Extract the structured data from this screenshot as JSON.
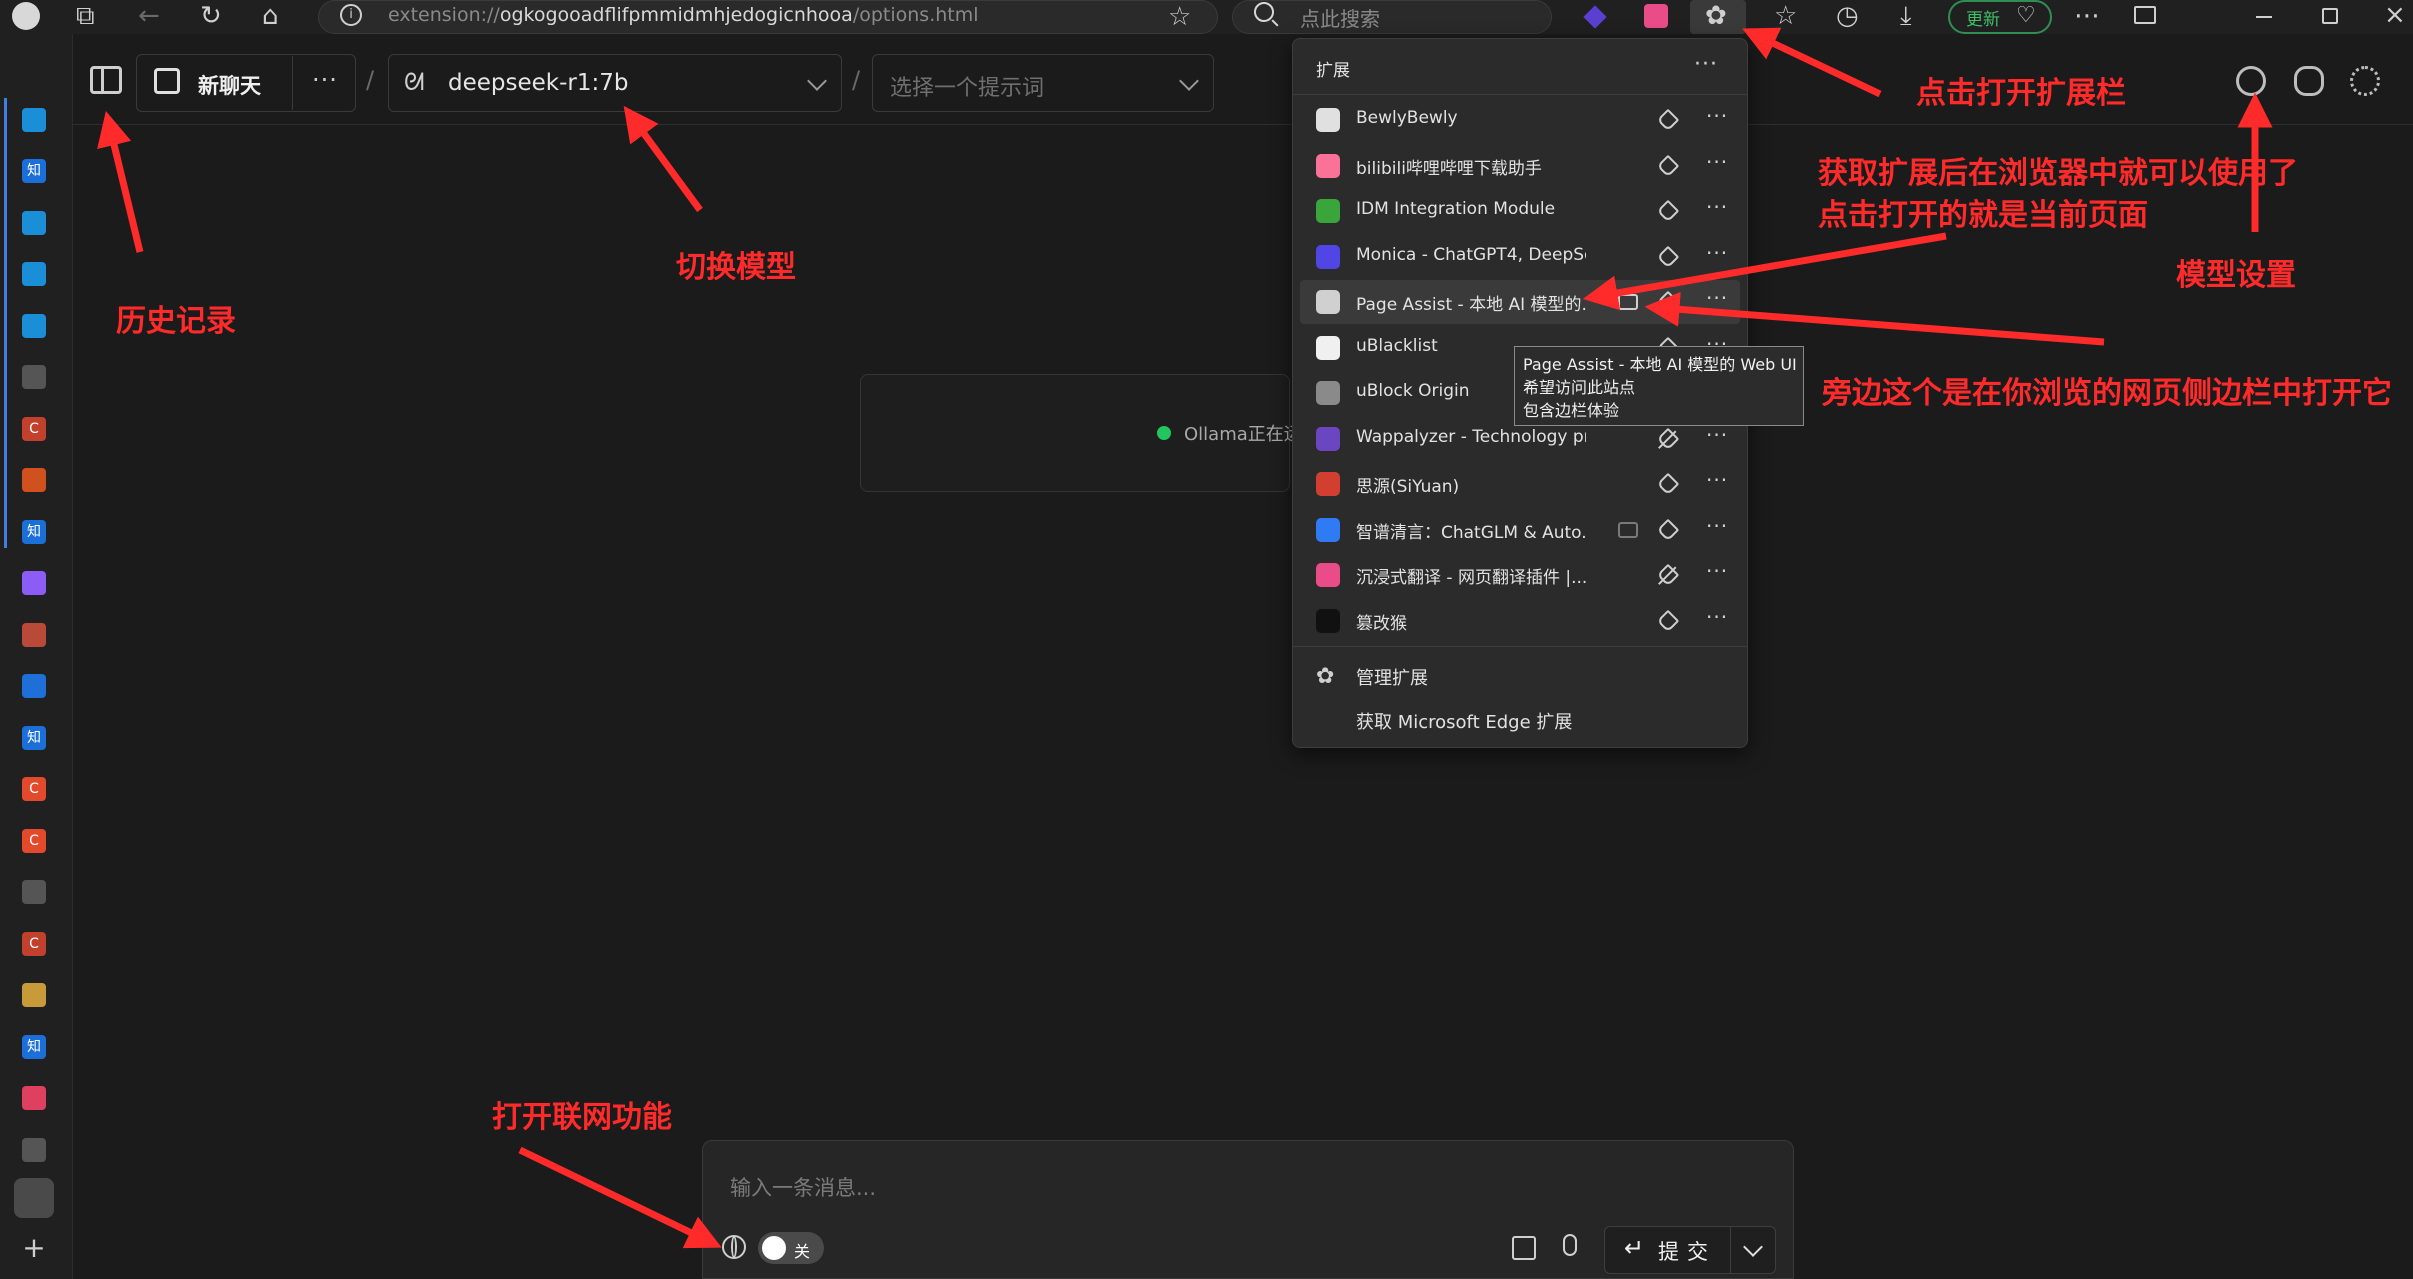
{
  "browser": {
    "url_prefix": "extension://",
    "url_host": "ogkogooadflifpmmidmhjedogicnhooa",
    "url_path": "/options.html",
    "search_placeholder": "点此搜索",
    "update_label": "更新"
  },
  "rail": {
    "items": [
      {
        "icon": "tab-icon",
        "text": "",
        "color": "#202020"
      },
      {
        "icon": "bilibili-icon",
        "text": "",
        "color": "#1a8fd8"
      },
      {
        "icon": "zhihu-icon",
        "text": "知",
        "color": "#1a6fd8"
      },
      {
        "icon": "bilibili-icon",
        "text": "",
        "color": "#1a8fd8"
      },
      {
        "icon": "bilibili-icon",
        "text": "",
        "color": "#1a8fd8"
      },
      {
        "icon": "bilibili-icon",
        "text": "",
        "color": "#1a8fd8"
      },
      {
        "icon": "bell-icon",
        "text": "",
        "color": "#555555"
      },
      {
        "icon": "c-icon",
        "text": "C",
        "color": "#c2412d"
      },
      {
        "icon": "ubuntu-icon",
        "text": "",
        "color": "#d0511d"
      },
      {
        "icon": "zhihu-icon",
        "text": "知",
        "color": "#1a6fd8"
      },
      {
        "icon": "app-icon",
        "text": "",
        "color": "#8b5cf6"
      },
      {
        "icon": "bus-icon",
        "text": "",
        "color": "#b94a3a"
      },
      {
        "icon": "search-icon",
        "text": "",
        "color": "#1e6fd8"
      },
      {
        "icon": "zhihu-icon",
        "text": "知",
        "color": "#1a6fd8"
      },
      {
        "icon": "c-icon",
        "text": "C",
        "color": "#e34a2b"
      },
      {
        "icon": "c-icon",
        "text": "C",
        "color": "#e34a2b"
      },
      {
        "icon": "bug-icon",
        "text": "",
        "color": "#555555"
      },
      {
        "icon": "c-icon",
        "text": "C",
        "color": "#c2412d"
      },
      {
        "icon": "house-icon",
        "text": "",
        "color": "#c79a3a"
      },
      {
        "icon": "zhihu-icon",
        "text": "知",
        "color": "#1a6fd8"
      },
      {
        "icon": "app-icon",
        "text": "",
        "color": "#e04060"
      },
      {
        "icon": "calendar-icon",
        "text": "",
        "color": "#555555"
      },
      {
        "icon": "chat-icon",
        "text": "",
        "color": "#4a4a4a"
      },
      {
        "icon": "plus-icon",
        "text": "+",
        "color": "#202020"
      }
    ]
  },
  "header": {
    "new_chat_label": "新聊天",
    "model_label": "deepseek-r1:7b",
    "prompt_placeholder": "选择一个提示词"
  },
  "status": {
    "text": "Ollama正在运"
  },
  "extensions_panel": {
    "title": "扩展",
    "items": [
      {
        "name": "BewlyBewly",
        "icon_color": "#e0e0e0",
        "pinned": true,
        "sidebar": false,
        "highlight": false
      },
      {
        "name": "bilibili哔哩哔哩下载助手",
        "icon_color": "#fb7299",
        "pinned": true,
        "sidebar": false,
        "highlight": false
      },
      {
        "name": "IDM Integration Module",
        "icon_color": "#3aa53a",
        "pinned": true,
        "sidebar": false,
        "highlight": false
      },
      {
        "name": "Monica - ChatGPT4, DeepSe...",
        "icon_color": "#4f46e5",
        "pinned": true,
        "sidebar": false,
        "highlight": false
      },
      {
        "name": "Page Assist - 本地 AI 模型的...",
        "icon_color": "#d0d0d0",
        "pinned": true,
        "sidebar": true,
        "highlight": true
      },
      {
        "name": "uBlacklist",
        "icon_color": "#f0f0f0",
        "pinned": true,
        "sidebar": false,
        "highlight": false
      },
      {
        "name": "uBlock Origin",
        "icon_color": "#8a8a8a",
        "pinned": true,
        "sidebar": false,
        "highlight": false
      },
      {
        "name": "Wappalyzer - Technology pr...",
        "icon_color": "#6b46c1",
        "pinned": false,
        "sidebar": false,
        "highlight": false
      },
      {
        "name": "思源(SiYuan)",
        "icon_color": "#d23f31",
        "pinned": true,
        "sidebar": false,
        "highlight": false
      },
      {
        "name": "智谱清言：ChatGLM & Auto...",
        "icon_color": "#2f7bf5",
        "pinned": true,
        "sidebar": true,
        "highlight": false
      },
      {
        "name": "沉浸式翻译 - 网页翻译插件 |...",
        "icon_color": "#ea4c89",
        "pinned": false,
        "sidebar": false,
        "highlight": false
      },
      {
        "name": "篡改猴",
        "icon_color": "#111111",
        "pinned": true,
        "sidebar": false,
        "highlight": false
      }
    ],
    "manage_label": "管理扩展",
    "get_label": "获取 Microsoft Edge 扩展"
  },
  "tooltip": {
    "line1": "Page Assist - 本地 AI 模型的 Web UI",
    "line2": "希望访问此站点",
    "line3": "包含边栏体验"
  },
  "composer": {
    "placeholder": "输入一条消息...",
    "toggle_label": "关",
    "submit_label": "提交"
  },
  "annotations": {
    "history": "历史记录",
    "switch_model": "切换模型",
    "open_extensions": "点击打开扩展栏",
    "get_extension_line1": "获取扩展后在浏览器中就可以使用了",
    "get_extension_line2": "点击打开的就是当前页面",
    "model_settings": "模型设置",
    "sidebar_note": "旁边这个是在你浏览的网页侧边栏中打开它",
    "web_search": "打开联网功能",
    "color": "#ff2a2a"
  }
}
